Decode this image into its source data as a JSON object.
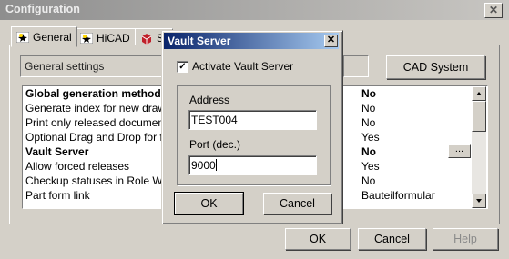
{
  "main": {
    "title": "Configuration",
    "close_glyph": "✕",
    "tabs": [
      {
        "label": "General",
        "icon": "star-icon"
      },
      {
        "label": "HiCAD",
        "icon": "star-icon"
      },
      {
        "label": "S",
        "icon": "cube-icon"
      }
    ],
    "general_settings_label": "General settings",
    "cad_system_button": "CAD System",
    "rows": [
      {
        "name": "Global generation method for file",
        "value": "No",
        "bold": true
      },
      {
        "name": "Generate index for new drawing",
        "value": "No",
        "bold": false
      },
      {
        "name": "Print only released documents",
        "value": "No",
        "bold": false
      },
      {
        "name": "Optional Drag and Drop for follow",
        "value": "Yes",
        "bold": false
      },
      {
        "name": "Vault Server",
        "value": "No",
        "bold": true,
        "ellipsis": "..."
      },
      {
        "name": "Allow forced releases",
        "value": "Yes",
        "bold": false
      },
      {
        "name": "Checkup statuses in Role Work",
        "value": "No",
        "bold": false
      },
      {
        "name": "Part form link",
        "value": "Bauteilformular",
        "bold": false
      }
    ],
    "buttons": {
      "ok": "OK",
      "cancel": "Cancel",
      "help": "Help"
    }
  },
  "dialog": {
    "title": "Vault Server",
    "close_glyph": "✕",
    "activate_label": "Activate Vault Server",
    "activate_checked": true,
    "check_glyph": "✓",
    "address_label": "Address",
    "address_value": "TEST004",
    "port_label": "Port (dec.)",
    "port_value": "9000",
    "ok_label": "OK",
    "cancel_label": "Cancel"
  }
}
